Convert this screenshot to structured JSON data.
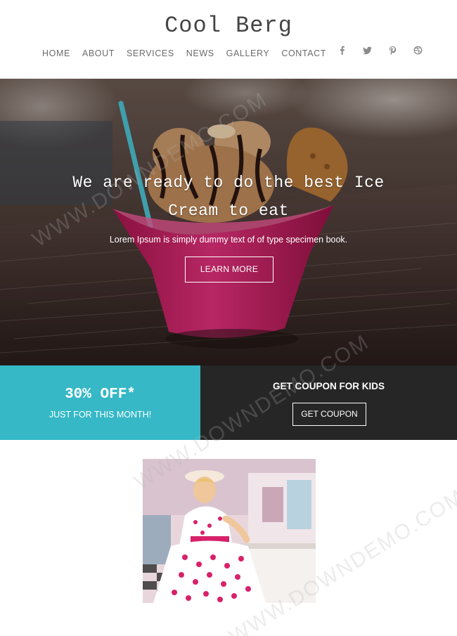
{
  "header": {
    "logo": "Cool Berg",
    "nav": [
      "HOME",
      "ABOUT",
      "SERVICES",
      "NEWS",
      "GALLERY",
      "CONTACT"
    ],
    "social_icons": [
      "facebook-icon",
      "twitter-icon",
      "pinterest-icon",
      "dribbble-icon"
    ]
  },
  "hero": {
    "title": "We are ready to do the best Ice Cream to eat",
    "subtitle": "Lorem Ipsum is simply dummy text of of type specimen book.",
    "button": "LEARN MORE"
  },
  "promo": {
    "offer": "30% OFF*",
    "offer_note": "JUST FOR THIS MONTH!",
    "kids_title": "GET COUPON FOR KIDS",
    "kids_button": "GET COUPON"
  },
  "watermark": "WWW.DOWNDEMO.COM",
  "colors": {
    "accent_teal": "#36b8c6",
    "dark_panel": "#262626",
    "cup_pink": "#d8216a"
  }
}
